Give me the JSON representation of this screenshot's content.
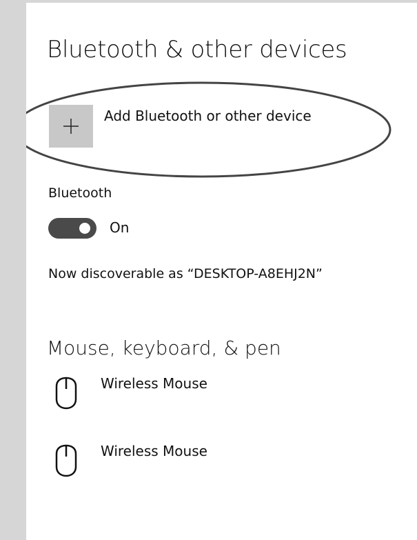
{
  "page": {
    "title": "Bluetooth & other devices"
  },
  "add_device": {
    "label": "Add Bluetooth or other device",
    "icon": "plus-icon"
  },
  "bluetooth": {
    "section_label": "Bluetooth",
    "toggle_state": "On",
    "toggle_on": true,
    "discoverable_text": "Now discoverable as “DESKTOP-A8EHJ2N”"
  },
  "devices_section": {
    "heading": "Mouse, keyboard, & pen",
    "items": [
      {
        "label": "Wireless Mouse",
        "icon": "mouse-icon"
      },
      {
        "label": "Wireless Mouse",
        "icon": "mouse-icon"
      }
    ]
  },
  "colors": {
    "rail": "#d6d6d6",
    "tile": "#c8c8c8",
    "toggle_track": "#4a4a4a",
    "annotation": "#444444"
  }
}
